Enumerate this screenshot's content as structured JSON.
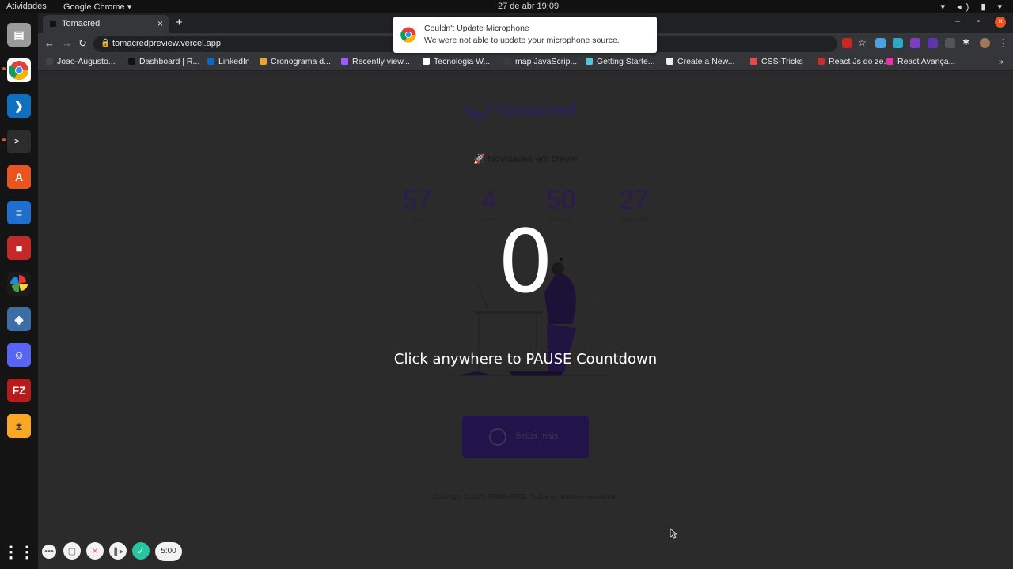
{
  "system": {
    "activities": "Atividades",
    "app_name": "Google Chrome ▾",
    "clock": "27 de abr  19:09",
    "tray": "▾ ◂) ▮ ▾"
  },
  "browser": {
    "tab_title": "Tomacred",
    "tab_close": "×",
    "new_tab": "+",
    "minimize": "–",
    "restore": "▫",
    "close": "×",
    "back": "←",
    "forward": "→",
    "reload": "↻",
    "url": "tomacredpreview.vercel.app",
    "menu": "⋮",
    "bookmarks": [
      {
        "label": "Joao-Augusto...",
        "color": "#444"
      },
      {
        "label": "Dashboard | R...",
        "color": "#111"
      },
      {
        "label": "LinkedIn",
        "color": "#0a66c2"
      },
      {
        "label": "Cronograma d...",
        "color": "#e8a33d"
      },
      {
        "label": "Recently view...",
        "color": "#a259ff"
      },
      {
        "label": "Tecnologia W...",
        "color": "#fff"
      },
      {
        "label": "map JavaScrip...",
        "color": "#3c3c3c"
      },
      {
        "label": "Getting Starte...",
        "color": "#58c4dc"
      },
      {
        "label": "Create a New...",
        "color": "#eee"
      },
      {
        "label": "CSS-Tricks",
        "color": "#e04d4d"
      },
      {
        "label": "React Js do ze...",
        "color": "#c4302b"
      },
      {
        "label": "React Avança...",
        "color": "#e535ab"
      }
    ],
    "bookmarks_more": "»"
  },
  "notification": {
    "title": "Couldn't Update Microphone",
    "body": "We were not able to update your microphone source."
  },
  "page": {
    "logo_text": "tomacred",
    "tagline": "🚀 Novidades em breve!",
    "countdown": [
      {
        "value": "57",
        "label": "Dias"
      },
      {
        "value": "4",
        "label": "Horas"
      },
      {
        "value": "50",
        "label": "Minutos"
      },
      {
        "value": "27",
        "label": "Segundos"
      }
    ],
    "separator": ":",
    "cta_label": "Saiba mais",
    "footer": "Copyright © 2021 TOMA CRED. Todos os direitos reservados."
  },
  "overlay": {
    "number": "0",
    "message": "Click anywhere to PAUSE Countdown"
  },
  "recorder": {
    "timer": "5:00"
  },
  "colors": {
    "accent": "#2f1f5a",
    "dock_indicator": "#e95420"
  }
}
